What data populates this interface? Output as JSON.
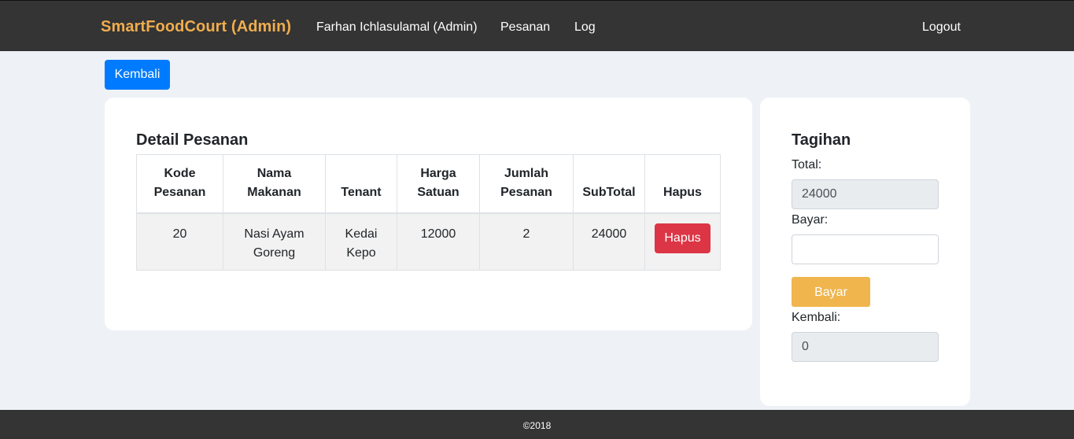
{
  "navbar": {
    "brand": "SmartFoodCourt (Admin)",
    "user": "Farhan Ichlasulamal (Admin)",
    "pesanan": "Pesanan",
    "log": "Log",
    "logout": "Logout"
  },
  "back_button": "Kembali",
  "detail": {
    "title": "Detail Pesanan",
    "headers": {
      "kode_line1": "Kode",
      "kode_line2": "Pesanan",
      "nama_line1": "Nama",
      "nama_line2": "Makanan",
      "tenant": "Tenant",
      "harga_line1": "Harga",
      "harga_line2": "Satuan",
      "jumlah_line1": "Jumlah",
      "jumlah_line2": "Pesanan",
      "subtotal": "SubTotal",
      "hapus": "Hapus"
    },
    "rows": [
      {
        "kode": "20",
        "nama_line1": "Nasi Ayam",
        "nama_line2": "Goreng",
        "tenant_line1": "Kedai",
        "tenant_line2": "Kepo",
        "harga": "12000",
        "jumlah": "2",
        "subtotal": "24000",
        "hapus_label": "Hapus"
      }
    ]
  },
  "tagihan": {
    "title": "Tagihan",
    "total_label": "Total:",
    "total_value": "24000",
    "bayar_label": "Bayar:",
    "bayar_value": "",
    "bayar_button": "Bayar",
    "kembali_label": "Kembali:",
    "kembali_value": "0"
  },
  "footer": "©2018"
}
